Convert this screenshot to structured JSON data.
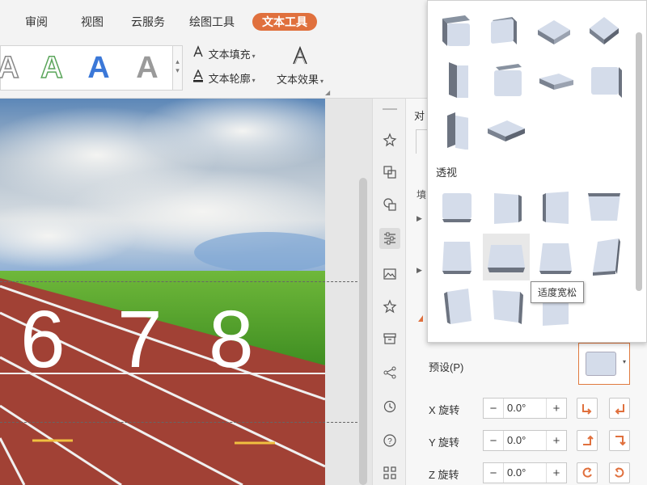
{
  "tabs": [
    {
      "label": "审阅"
    },
    {
      "label": "视图"
    },
    {
      "label": "云服务"
    },
    {
      "label": "绘图工具"
    },
    {
      "label": "文本工具"
    }
  ],
  "active_tab": "文本工具",
  "ribbon": {
    "style_gallery": [
      "A",
      "A",
      "A",
      "A"
    ],
    "text_fill_label": "文本填充",
    "text_outline_label": "文本轮廓",
    "text_effect_label": "文本效果"
  },
  "slide": {
    "digits": [
      "6",
      "7",
      "8"
    ]
  },
  "panel": {
    "partial_label": "对",
    "preset_label": "预设(P)",
    "x_rotation_label": "X 旋转",
    "y_rotation_label": "Y 旋转",
    "z_rotation_label": "Z 旋转",
    "x_value": "0.0°",
    "y_value": "0.0°",
    "z_value": "0.0°",
    "minus": "−",
    "plus": "+"
  },
  "dropdown": {
    "section_perspective": "透视",
    "tooltip": "适度宽松"
  },
  "colors": {
    "accent": "#e0703d",
    "shape_face": "#d4dcea",
    "track": "#a8463a"
  }
}
